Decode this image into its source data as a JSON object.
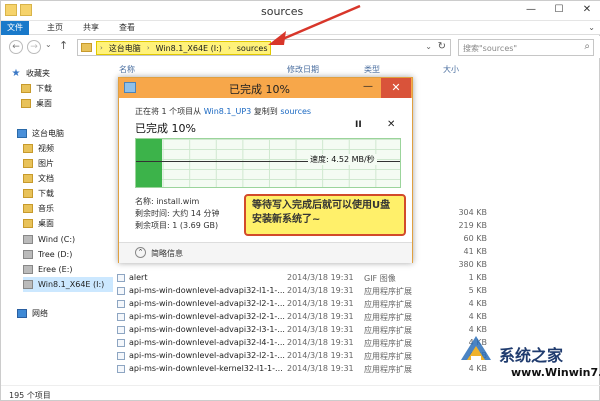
{
  "window": {
    "title": "sources"
  },
  "ribbon": {
    "tabs": [
      "文件",
      "主页",
      "共享",
      "查看"
    ]
  },
  "address": {
    "crumbs": [
      "这台电脑",
      "Win8.1_X64E (I:)",
      "sources"
    ],
    "search_placeholder": "搜索\"sources\""
  },
  "nav": {
    "items": [
      {
        "label": "收藏夹",
        "icon": "star-icon"
      },
      {
        "label": "下载",
        "icon": "folder-icon"
      },
      {
        "label": "桌面",
        "icon": "folder-icon"
      },
      {
        "label": "这台电脑",
        "icon": "computer-icon"
      },
      {
        "label": "视频",
        "icon": "folder-icon"
      },
      {
        "label": "图片",
        "icon": "folder-icon"
      },
      {
        "label": "文档",
        "icon": "folder-icon"
      },
      {
        "label": "下载",
        "icon": "folder-icon"
      },
      {
        "label": "音乐",
        "icon": "folder-icon"
      },
      {
        "label": "桌面",
        "icon": "folder-icon"
      },
      {
        "label": "Wind (C:)",
        "icon": "drive-icon"
      },
      {
        "label": "Tree (D:)",
        "icon": "drive-icon"
      },
      {
        "label": "Eree (E:)",
        "icon": "drive-icon"
      },
      {
        "label": "Win8.1_X64E (I:)",
        "icon": "drive-icon"
      },
      {
        "label": "网络",
        "icon": "network-icon"
      }
    ]
  },
  "columns": {
    "name": "名称",
    "date": "修改日期",
    "type": "类型",
    "size": "大小"
  },
  "hidden_sizes": [
    "304 KB",
    "219 KB",
    "60 KB",
    "41 KB",
    "380 KB",
    "56 KB"
  ],
  "files": [
    {
      "name": "alert",
      "date": "2014/3/18 19:31",
      "type": "GIF 图像",
      "size": "1 KB"
    },
    {
      "name": "api-ms-win-downlevel-advapi32-l1-1-...",
      "date": "2014/3/18 19:31",
      "type": "应用程序扩展",
      "size": "5 KB"
    },
    {
      "name": "api-ms-win-downlevel-advapi32-l2-1-...",
      "date": "2014/3/18 19:31",
      "type": "应用程序扩展",
      "size": "4 KB"
    },
    {
      "name": "api-ms-win-downlevel-advapi32-l2-1-...",
      "date": "2014/3/18 19:31",
      "type": "应用程序扩展",
      "size": "4 KB"
    },
    {
      "name": "api-ms-win-downlevel-advapi32-l3-1-...",
      "date": "2014/3/18 19:31",
      "type": "应用程序扩展",
      "size": "4 KB"
    },
    {
      "name": "api-ms-win-downlevel-advapi32-l4-1-...",
      "date": "2014/3/18 19:31",
      "type": "应用程序扩展",
      "size": "4 KB"
    },
    {
      "name": "api-ms-win-downlevel-advapi32-l2-1-...",
      "date": "2014/3/18 19:31",
      "type": "应用程序扩展",
      "size": "4 KB"
    },
    {
      "name": "api-ms-win-downlevel-kernel32-l1-1-...",
      "date": "2014/3/18 19:31",
      "type": "应用程序扩展",
      "size": "4 KB"
    }
  ],
  "status": {
    "count": "195 个项目"
  },
  "dialog": {
    "title": "已完成 10%",
    "line_prefix": "正在将 1 个项目从",
    "source": "Win8.1_UP3",
    "line_mid": "复制到",
    "dest": "sources",
    "percent_label": "已完成 10%",
    "progress": 0.1,
    "speed": "速度: 4.52 MB/秒",
    "name": "名称: install.wim",
    "time_left": "剩余时间: 大约 14 分钟",
    "items_left": "剩余项目: 1 (3.69 GB)",
    "details": "简略信息"
  },
  "callout": {
    "text": "等待写入完成后就可以使用U盘安装新系统了~"
  },
  "watermark": {
    "brand": "系统之家",
    "url": "www.Winwin7.com"
  },
  "colors": {
    "accent": "#1979ca",
    "dialog_title": "#f7a74a",
    "progress": "#3cb34a",
    "highlight": "#fff27a",
    "callout_border": "#d24a2a"
  }
}
